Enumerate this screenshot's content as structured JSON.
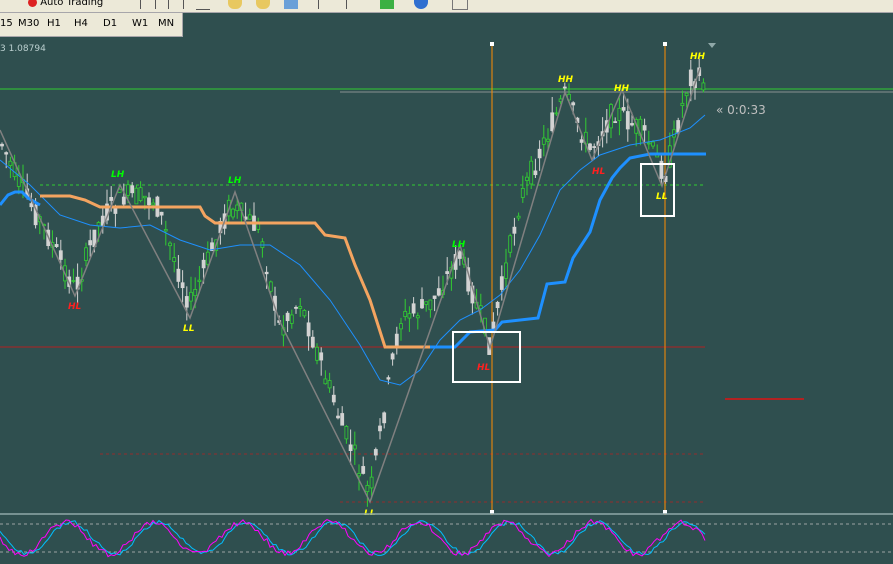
{
  "toolbar": {
    "auto_trading_label": "Auto Trading",
    "icons": [
      "chart-bars-icon",
      "chart-candles-icon",
      "chart-line-icon",
      "zoom-in-icon",
      "zoom-out-icon",
      "tile-windows-icon",
      "scroll-chart-icon",
      "autoscroll-icon",
      "new-order-icon",
      "navigator-icon",
      "charts-icon"
    ]
  },
  "timeframes": [
    "15",
    "M30",
    "H1",
    "H4",
    "D1",
    "W1",
    "MN"
  ],
  "symbol_info": "3 1.08794",
  "countdown": "« 0:0:33",
  "swing_labels": [
    {
      "text": "LH",
      "color": "#00ff00"
    },
    {
      "text": "LH",
      "color": "#00ff00"
    },
    {
      "text": "HL",
      "color": "#ff2020"
    },
    {
      "text": "LL",
      "color": "#ffff00"
    },
    {
      "text": "LL",
      "color": "#ffff00"
    },
    {
      "text": "LH",
      "color": "#00ff00"
    },
    {
      "text": "HL",
      "color": "#ff2020"
    },
    {
      "text": "HH",
      "color": "#ffff00"
    },
    {
      "text": "HH",
      "color": "#ffff00"
    },
    {
      "text": "HL",
      "color": "#ff2020"
    },
    {
      "text": "LL",
      "color": "#ffff00"
    },
    {
      "text": "HH",
      "color": "#ffff00"
    }
  ],
  "colors": {
    "background": "#2f4f4f",
    "bull_candle": "#32cd32",
    "bear_candle": "#d3d3d3",
    "ma_fast": "#1e90ff",
    "supertrend_up": "#1e90ff",
    "supertrend_down": "#f4a460",
    "zigzag": "#808080",
    "support_line": "#b22222",
    "vline": "#ff8c00",
    "highlight_box": "#ffffff",
    "oscillator_main": "#ff00ff",
    "oscillator_signal": "#00bfff"
  }
}
